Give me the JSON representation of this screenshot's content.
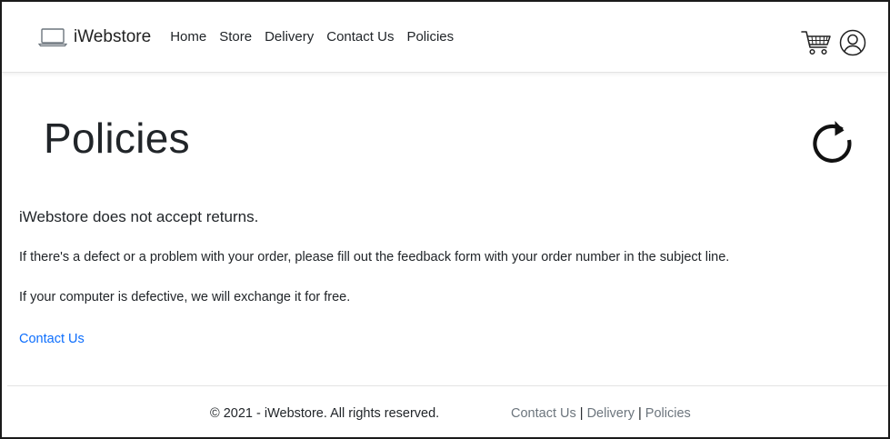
{
  "navbar": {
    "brand": "iWebstore",
    "links": [
      "Home",
      "Store",
      "Delivery",
      "Contact Us",
      "Policies"
    ]
  },
  "page": {
    "title": "Policies"
  },
  "content": {
    "lead": "iWebstore does not accept returns.",
    "paragraphs": [
      "If there's a defect or a problem with your order, please fill out the feedback form with your order number in the subject line.",
      "If your computer is defective, we will exchange it for free."
    ],
    "contact_link": "Contact Us"
  },
  "footer": {
    "copyright": "© 2021 - iWebstore. All rights reserved.",
    "links": [
      "Contact Us",
      "Delivery",
      "Policies"
    ],
    "separator": "|"
  },
  "colors": {
    "link": "#0d6efd",
    "footer_link": "#6c757d",
    "text": "#212529"
  },
  "icons": {
    "brand": "laptop-icon",
    "cart": "cart-icon",
    "user": "user-circle-icon",
    "refresh": "refresh-icon"
  }
}
